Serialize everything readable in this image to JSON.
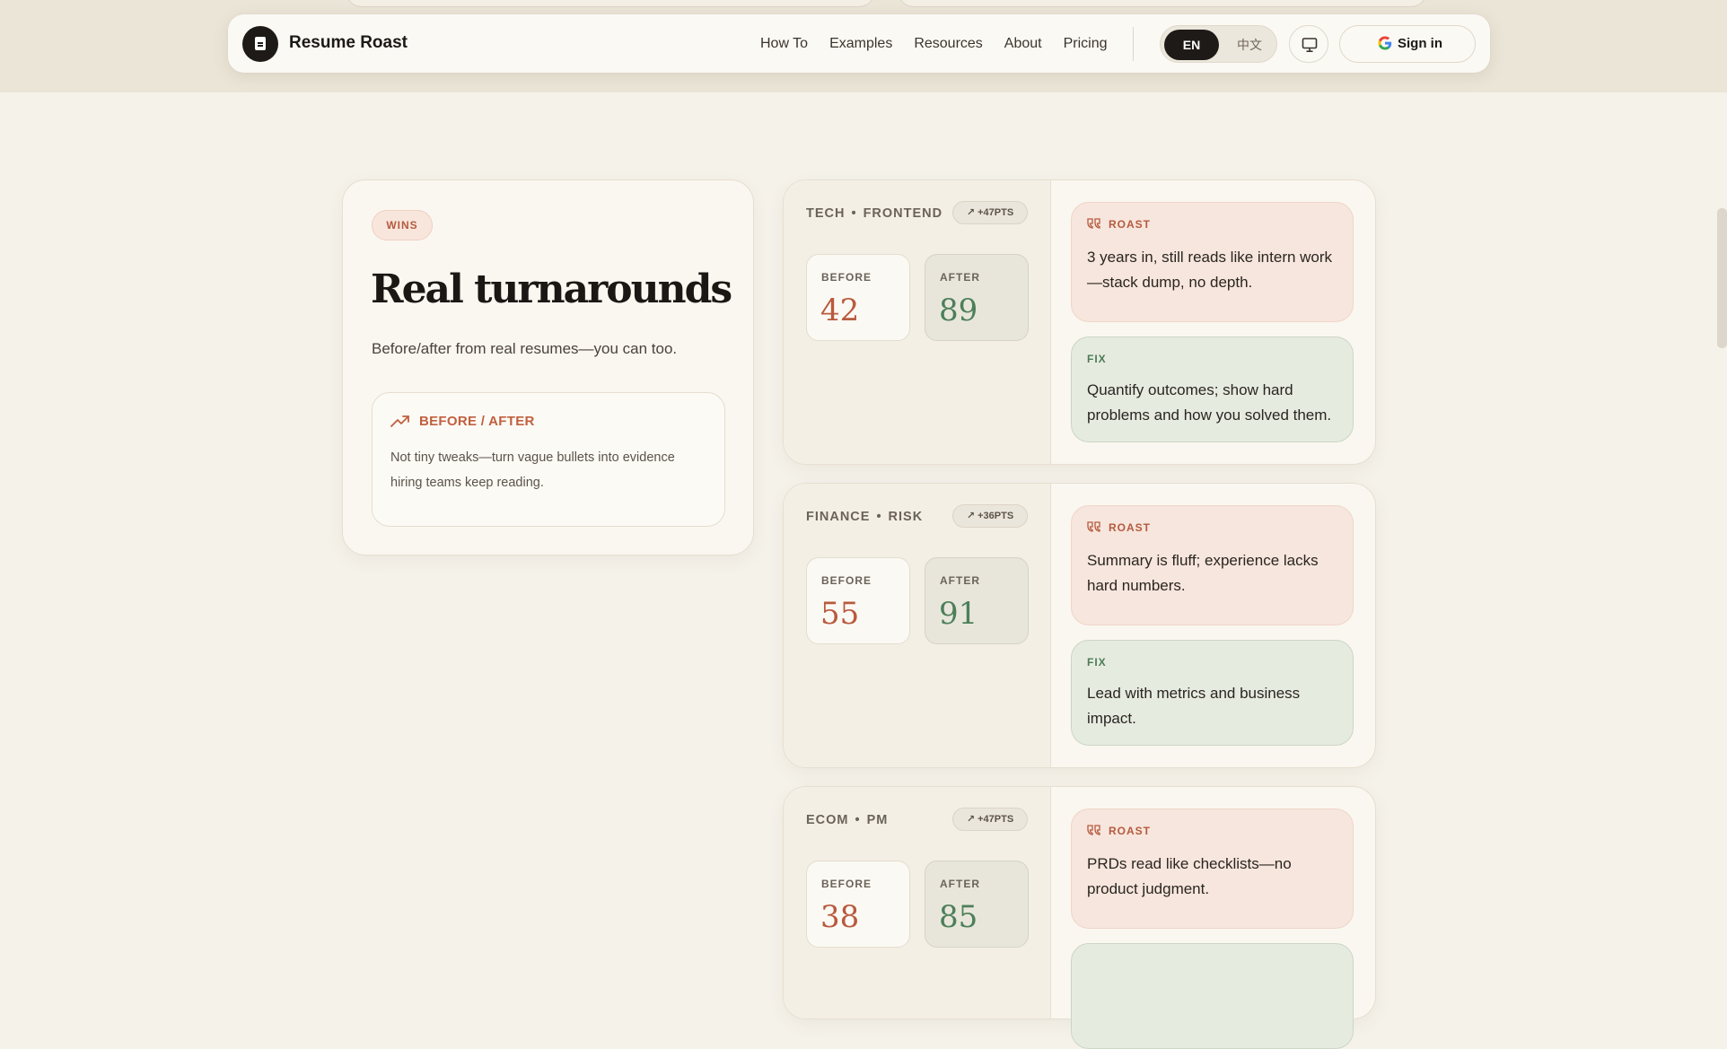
{
  "nav": {
    "brand": "Resume Roast",
    "links": [
      "How To",
      "Examples",
      "Resources",
      "About",
      "Pricing"
    ],
    "lang_en": "EN",
    "lang_zh": "中文",
    "signin": "Sign in"
  },
  "intro": {
    "badge": "WINS",
    "title": "Real turnarounds",
    "subtitle": "Before/after from real resumes—you can too.",
    "box_title": "BEFORE / AFTER",
    "box_text": "Not tiny tweaks—turn vague bullets into evidence hiring teams keep reading."
  },
  "labels": {
    "before": "BEFORE",
    "after": "AFTER",
    "roast": "ROAST",
    "fix": "FIX",
    "dot": "•"
  },
  "cases": [
    {
      "field": "TECH",
      "role": "FRONTEND",
      "pts": "+47PTS",
      "before": "42",
      "after": "89",
      "roast": "3 years in, still reads like intern work—stack dump, no depth.",
      "fix": "Quantify outcomes; show hard problems and how you solved them."
    },
    {
      "field": "FINANCE",
      "role": "RISK",
      "pts": "+36PTS",
      "before": "55",
      "after": "91",
      "roast": "Summary is fluff; experience lacks hard numbers.",
      "fix": "Lead with metrics and business impact."
    },
    {
      "field": "ECOM",
      "role": "PM",
      "pts": "+47PTS",
      "before": "38",
      "after": "85",
      "roast": "PRDs read like checklists—no product judgment.",
      "fix": ""
    }
  ],
  "colors": {
    "accent_roast": "#b55a3e",
    "accent_fix": "#4b7c56",
    "background": "#f5f2ea"
  }
}
